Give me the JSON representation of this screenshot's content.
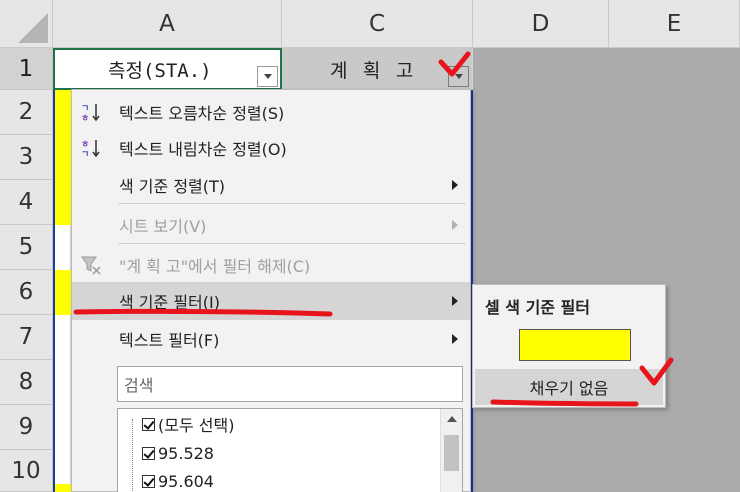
{
  "columns": [
    "A",
    "C",
    "D",
    "E"
  ],
  "rows": [
    "1",
    "2",
    "3",
    "4",
    "5",
    "6",
    "7",
    "8",
    "9",
    "10"
  ],
  "header_row": {
    "a1": "측정(STA.)",
    "c1": "계 획 고"
  },
  "menu": {
    "items": [
      {
        "label": "텍스트 오름차순 정렬(S)",
        "icon": "sort-ascending-icon"
      },
      {
        "label": "텍스트 내림차순 정렬(O)",
        "icon": "sort-descending-icon"
      },
      {
        "label": "색 기준 정렬(T)"
      },
      {
        "label": "시트 보기(V)"
      },
      {
        "label": "\"계 획 고\"에서 필터 해제(C)",
        "icon": "clear-filter-icon"
      },
      {
        "label": "색 기준 필터(I)"
      },
      {
        "label": "텍스트 필터(F)"
      }
    ],
    "search_placeholder": "검색",
    "list": [
      "(모두 선택)",
      "95.528",
      "95.604"
    ]
  },
  "submenu": {
    "title": "셀 색 기준 필터",
    "swatch_color": "#ffff00",
    "no_fill_label": "채우기 없음"
  },
  "colors": {
    "annotation_red": "#e8141c",
    "highlight_yellow": "#ffff00"
  }
}
